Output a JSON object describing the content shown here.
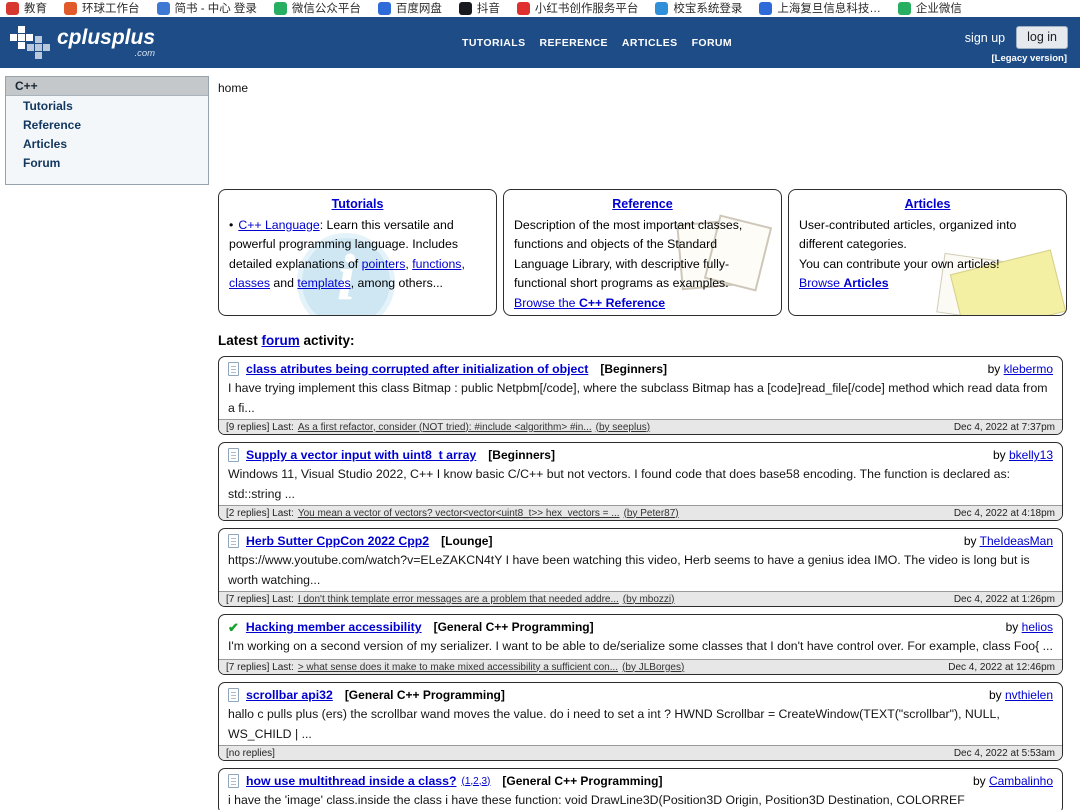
{
  "bookmarks": {
    "items": [
      {
        "label": "教育",
        "color": "#d6372e"
      },
      {
        "label": "环球工作台",
        "color": "#e05a2b"
      },
      {
        "label": "简书 - 中心 登录",
        "color": "#3d79d3"
      },
      {
        "label": "微信公众平台",
        "color": "#27ae60"
      },
      {
        "label": "百度网盘",
        "color": "#2f6bd8"
      },
      {
        "label": "抖音",
        "color": "#17191f"
      },
      {
        "label": "小红书创作服务平台",
        "color": "#e02f2f"
      },
      {
        "label": "校宝系统登录",
        "color": "#2f8fd8"
      },
      {
        "label": "上海复旦信息科技…",
        "color": "#2f6bd8"
      },
      {
        "label": "企业微信",
        "color": "#27ae60"
      }
    ]
  },
  "header": {
    "logo_text": "cplusplus",
    "logo_suffix": ".com",
    "nav": [
      "TUTORIALS",
      "REFERENCE",
      "ARTICLES",
      "FORUM"
    ],
    "signup_label": "sign up",
    "login_label": "log in",
    "legacy_label": "[Legacy version]"
  },
  "sidebar": {
    "title": "C++",
    "items": [
      "Tutorials",
      "Reference",
      "Articles",
      "Forum"
    ]
  },
  "breadcrumb": "home",
  "icons": {
    "check": "✔",
    "bullet": "•"
  },
  "promos": {
    "tutorials": {
      "title": "Tutorials",
      "link_language": "C++ Language",
      "t1": ": Learn this versatile and powerful programming language. Includes detailed explanations of ",
      "link_pointers": "pointers",
      "t2": ", ",
      "link_functions": "functions",
      "t3": ", ",
      "link_classes": "classes",
      "t4": " and ",
      "link_templates": "templates",
      "t5": ", among others..."
    },
    "reference": {
      "title": "Reference",
      "text": "Description of the most important classes, functions and objects of the Standard Language Library, with descriptive fully-functional short programs as examples.",
      "browse_pre": "Browse the ",
      "browse_bold": "C++ Reference"
    },
    "articles": {
      "title": "Articles",
      "text1": "User-contributed articles, organized into different categories.",
      "text2": "You can contribute your own articles!",
      "browse_pre": "Browse ",
      "browse_bold": "Articles"
    }
  },
  "forum": {
    "heading_pre": "Latest ",
    "heading_link": "forum",
    "heading_post": " activity:",
    "posts": [
      {
        "title": "class atributes being corrupted after initialization of object",
        "pages": "",
        "category": "[Beginners]",
        "by_label": "by ",
        "author": "klebermo",
        "excerpt": "I have trying implement this class Bitmap : public Netpbm[/code], where the subclass Bitmap has a [code]read_file[/code] method which read data from a fi...",
        "replies": "[9 replies] Last:",
        "last_link": "As a first refactor, consider (NOT tried): #include <algorithm> #in...",
        "last_by": "(by seeplus)",
        "date": "Dec 4, 2022 at 7:37pm"
      },
      {
        "title": "Supply a vector input with uint8_t array",
        "pages": "",
        "category": "[Beginners]",
        "by_label": "by ",
        "author": "bkelly13",
        "excerpt": "Windows 11, Visual Studio 2022, C++ I know basic C/C++ but not vectors. I found code that does base58 encoding. The function is declared as: std::string ...",
        "replies": "[2 replies] Last:",
        "last_link": "You mean a vector of vectors? vector<vector<uint8_t>> hex_vectors = ...",
        "last_by": "(by Peter87)",
        "date": "Dec 4, 2022 at 4:18pm"
      },
      {
        "title": "Herb Sutter CppCon 2022 Cpp2",
        "pages": "",
        "category": "[Lounge]",
        "by_label": "by ",
        "author": "TheIdeasMan",
        "excerpt": "https://www.youtube.com/watch?v=ELeZAKCN4tY I have been watching this video, Herb seems to have a genius idea IMO. The video is long but is worth watching...",
        "replies": "[7 replies] Last:",
        "last_link": "I don't think template error messages are a problem that needed addre...",
        "last_by": "(by mbozzi)",
        "date": "Dec 4, 2022 at 1:26pm"
      },
      {
        "title": "Hacking member accessibility",
        "pages": "",
        "category": "[General C++ Programming]",
        "by_label": "by ",
        "author": "helios",
        "excerpt": "I'm working on a second version of my serializer. I want to be able to de/serialize some classes that I don't have control over. For example, class Foo{ ...",
        "replies": "[7 replies] Last:",
        "last_link": "> what sense does it make to make mixed accessibility a sufficient con...",
        "last_by": "(by JLBorges)",
        "date": "Dec 4, 2022 at 12:46pm"
      },
      {
        "title": "scrollbar api32",
        "pages": "",
        "category": "[General C++ Programming]",
        "by_label": "by ",
        "author": "nvthielen",
        "excerpt": "hallo c pulls plus (ers) the scrollbar wand moves the value. do i need to set a int ? HWND Scrollbar = CreateWindow(TEXT(\"scrollbar\"), NULL, WS_CHILD | ...",
        "replies": "[no replies]",
        "last_link": "",
        "last_by": "",
        "date": "Dec 4, 2022 at 5:53am"
      },
      {
        "title": "how use multithread inside a class?",
        "pages": "(1,2,3)",
        "category": "[General C++ Programming]",
        "by_label": "by ",
        "author": "Cambalinho",
        "excerpt": "i have the 'image' class.inside the class i have these function: void DrawLine3D(Position3D Origin, Position3D Destination, COLORREF",
        "replies": "",
        "last_link": "",
        "last_by": "",
        "date": ""
      }
    ]
  }
}
